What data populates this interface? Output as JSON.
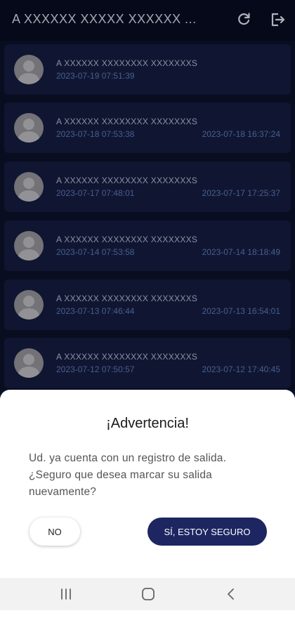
{
  "app_title": "A XXXXXX  XXXXX  XXXXXX ...",
  "icons": {
    "refresh": "refresh-icon",
    "logout": "logout-icon",
    "avatar": "person-silhouette-icon"
  },
  "records": [
    {
      "name": "A XXXXXX  XXXXXXXX  XXXXXXXS",
      "entry": "2023-07-19 07:51:39",
      "exit": ""
    },
    {
      "name": "A XXXXXX  XXXXXXXX  XXXXXXXS",
      "entry": "2023-07-18 07:53:38",
      "exit": "2023-07-18 16:37:24"
    },
    {
      "name": "A XXXXXX  XXXXXXXX  XXXXXXXS",
      "entry": "2023-07-17 07:48:01",
      "exit": "2023-07-17 17:25:37"
    },
    {
      "name": "A XXXXXX  XXXXXXXX  XXXXXXXS",
      "entry": "2023-07-14 07:53:58",
      "exit": "2023-07-14 18:18:49"
    },
    {
      "name": "A XXXXXX  XXXXXXXX  XXXXXXXS",
      "entry": "2023-07-13 07:46:44",
      "exit": "2023-07-13 16:54:01"
    },
    {
      "name": "A XXXXXX  XXXXXXXX  XXXXXXXS",
      "entry": "2023-07-12 07:50:57",
      "exit": "2023-07-12 17:40:45"
    }
  ],
  "dialog": {
    "title": "¡Advertencia!",
    "message": "Ud. ya cuenta con un registro de salida. ¿Seguro que desea marcar su salida nuevamente?",
    "no_label": "NO",
    "yes_label": "SÍ, ESTOY SEGURO"
  },
  "colors": {
    "background": "#0a1028",
    "card": "#141c3c",
    "timestamp": "#5773b0",
    "primary_button": "#1d2660"
  },
  "navbar": {
    "recent": "recent-apps-icon",
    "home": "home-icon",
    "back": "back-icon"
  }
}
